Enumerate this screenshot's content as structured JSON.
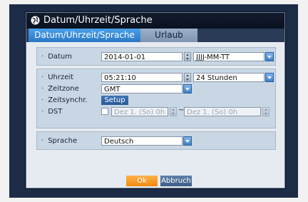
{
  "window": {
    "title": "Datum/Uhrzeit/Sprache",
    "colors": {
      "title_bg": "#0a1120",
      "active_tab": "#2a78c6",
      "ok_button": "#f08a10"
    }
  },
  "tabs": [
    {
      "label": "Datum/Uhrzeit/Sprache",
      "active": true
    },
    {
      "label": "Urlaub",
      "active": false
    }
  ],
  "date_group": {
    "datum_label": "Datum",
    "datum_value": "2014-01-01",
    "format_value": "JJJJ-MM-TT"
  },
  "time_group": {
    "uhrzeit_label": "Uhrzeit",
    "uhrzeit_value": "05:21:10",
    "hour_mode_value": "24 Stunden",
    "zeitzone_label": "Zeitzone",
    "zeitzone_value": "GMT",
    "zeitsynchr_label": "Zeitsynchr.",
    "setup_label": "Setup",
    "dst_label": "DST",
    "dst_start_value": "Dez 1. (So) 0h",
    "dst_separator": "~",
    "dst_end_value": "Dez 1. (So) 0h",
    "dst_enabled": false
  },
  "language_group": {
    "sprache_label": "Sprache",
    "sprache_value": "Deutsch"
  },
  "buttons": {
    "ok_label": "Ok",
    "abbruch_label": "Abbruch"
  },
  "icons": {
    "title_icon": "globe-icon"
  }
}
